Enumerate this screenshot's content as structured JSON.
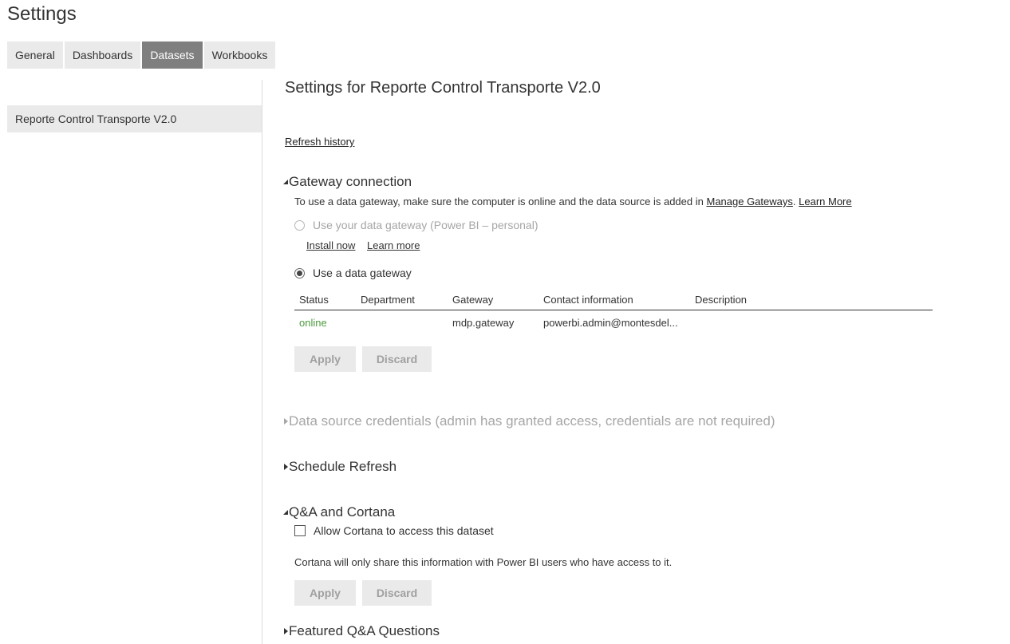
{
  "page": {
    "title": "Settings"
  },
  "tabs": [
    {
      "label": "General",
      "active": false
    },
    {
      "label": "Dashboards",
      "active": false
    },
    {
      "label": "Datasets",
      "active": true
    },
    {
      "label": "Workbooks",
      "active": false
    }
  ],
  "left_list": {
    "items": [
      "Reporte Control Transporte V2.0"
    ]
  },
  "main": {
    "title": "Settings for Reporte Control Transporte V2.0",
    "refresh_history": "Refresh history",
    "gateway": {
      "heading": "Gateway connection",
      "note": "To use a data gateway, make sure the computer is online and the data source is added in",
      "manage_gateways": "Manage Gateways",
      "note_sep": ".",
      "learn_more_top": "Learn More",
      "personal_option": "Use your data gateway (Power BI – personal)",
      "install_now": "Install now",
      "learn_more": "Learn more",
      "data_gateway_option": "Use a data gateway",
      "table": {
        "headers": [
          "Status",
          "Department",
          "Gateway",
          "Contact information",
          "Description"
        ],
        "rows": [
          {
            "status": "online",
            "department": "",
            "gateway": "mdp.gateway",
            "contact": "powerbi.admin@montesdel...",
            "description": ""
          }
        ]
      },
      "apply": "Apply",
      "discard": "Discard"
    },
    "credentials": {
      "heading": "Data source credentials (admin has granted access, credentials are not required)"
    },
    "schedule": {
      "heading": "Schedule Refresh"
    },
    "qa": {
      "heading": "Q&A and Cortana",
      "checkbox_label": "Allow Cortana to access this dataset",
      "note": "Cortana will only share this information with Power BI users who have access to it.",
      "apply": "Apply",
      "discard": "Discard"
    },
    "featured": {
      "heading": "Featured Q&A Questions"
    }
  },
  "colors": {
    "tab_active_bg": "#7f7f7f",
    "tab_bg": "#eaeaea",
    "online": "#4b9b3c",
    "muted": "#a6a6a6"
  }
}
